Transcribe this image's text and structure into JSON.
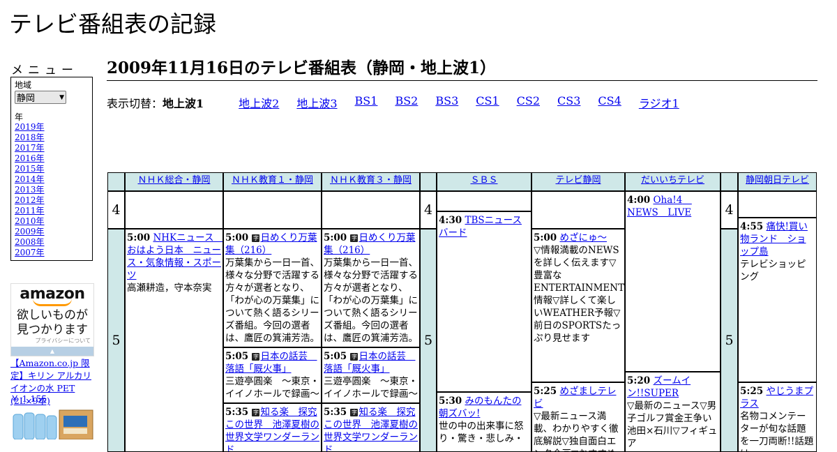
{
  "site": {
    "title": "テレビ番組表の記録"
  },
  "menu": {
    "heading": "メニュー",
    "region_label": "地域",
    "region_value": "静岡",
    "year_label": "年",
    "years": [
      "2019年",
      "2018年",
      "2017年",
      "2016年",
      "2015年",
      "2014年",
      "2013年",
      "2012年",
      "2011年",
      "2010年",
      "2009年",
      "2008年",
      "2007年"
    ]
  },
  "ad": {
    "logo": "amazon",
    "copy_line1": "欲しいものが",
    "copy_line2": "見つかります",
    "privacy": "プライバシーについて",
    "product": "【Amazon.co.jp 限定】キリン アルカリイオンの水 PET (2L×9本)",
    "price": "￥ 1,155"
  },
  "page": {
    "heading": "2009年11月16日のテレビ番組表（静岡・地上波1）"
  },
  "switcher": {
    "label": "表示切替：",
    "current": "地上波1",
    "links": [
      "地上波2",
      "地上波3",
      "BS1",
      "BS2",
      "BS3",
      "CS1",
      "CS2",
      "CS3",
      "CS4",
      "ラジオ1"
    ]
  },
  "channels": [
    "ＮＨＫ総合・静岡",
    "ＮＨＫ教育１・静岡",
    "ＮＨＫ教育３・静岡",
    "ＳＢＳ",
    "テレビ静岡",
    "だいいちテレビ",
    "静岡朝日テレビ"
  ],
  "hours": {
    "h4": "4",
    "h5": "5"
  },
  "programs": {
    "nhk_g_500": {
      "time": "5:00",
      "title": "NHKニュース　おはよう日本　ニュース・気象情報・スポーツ",
      "desc": "高瀬耕造，守本奈実"
    },
    "e1_500": {
      "time": "5:00",
      "badge": "字",
      "title": "日めくり万葉集（216）",
      "desc": "万葉集から一日一首、様々な分野で活躍する方々が選者となり、「わが心の万葉集」について熱く語るシリーズ番組。今回の選者は、鷹匠の箕浦芳浩。"
    },
    "e1_505": {
      "time": "5:05",
      "badge": "字",
      "title": "日本の話芸　落語「厩火事」",
      "desc": "三遊亭圓楽　～東京・イイノホールで録画～"
    },
    "e1_535": {
      "time": "5:35",
      "badge": "字",
      "title": "知る楽　探究この世界　池澤夏樹の世界文学ワンダーランド"
    },
    "e3_500": {
      "time": "5:00",
      "badge": "字",
      "title": "日めくり万葉集（216）",
      "desc": "万葉集から一日一首、様々な分野で活躍する方々が選者となり、「わが心の万葉集」について熱く語るシリーズ番組。今回の選者は、鷹匠の箕浦芳浩。"
    },
    "e3_505": {
      "time": "5:05",
      "badge": "字",
      "title": "日本の話芸　落語「厩火事」",
      "desc": "三遊亭圓楽　～東京・イイノホールで録画～"
    },
    "e3_535": {
      "time": "5:35",
      "badge": "字",
      "title": "知る楽　探究この世界　池澤夏樹の世界文学ワンダーランド"
    },
    "sbs_430": {
      "time": "4:30",
      "title": "TBSニュースバード"
    },
    "sbs_530": {
      "time": "5:30",
      "title": "みのもんたの朝ズバッ!",
      "desc": "世の中の出来事に怒り・驚き・悲しみ・"
    },
    "tvs_500": {
      "time": "5:00",
      "title": "めざにゅ～",
      "desc": "▽情報満載のNEWSを詳しく伝えます▽豊富なENTERTAINMENT情報▽詳しくて楽しいWEATHER予報▽前日のSPORTSたっぷり見せます"
    },
    "tvs_525": {
      "time": "5:25",
      "title": "めざましテレビ",
      "desc": "▽最新ニュース満載、わかりやすく徹底解説▽独自面白エンタ企画▽おすすめの"
    },
    "dai_400": {
      "time": "4:00",
      "title": "Oha!4　NEWS　LIVE"
    },
    "dai_520": {
      "time": "5:20",
      "title": "ズームイン!!SUPER",
      "desc": "▽最新のニュース▽男子ゴルフ賞金王争い　池田×石川▽フィギュア"
    },
    "asahi_455": {
      "time": "4:55",
      "title": "痛快!買い物ランド　ショップ島",
      "desc": "テレビショッピング"
    },
    "asahi_525": {
      "time": "5:25",
      "title": "やじうまプラス",
      "desc": "名物コメンテーターが旬な話題を一刀両断!!話題は"
    }
  }
}
